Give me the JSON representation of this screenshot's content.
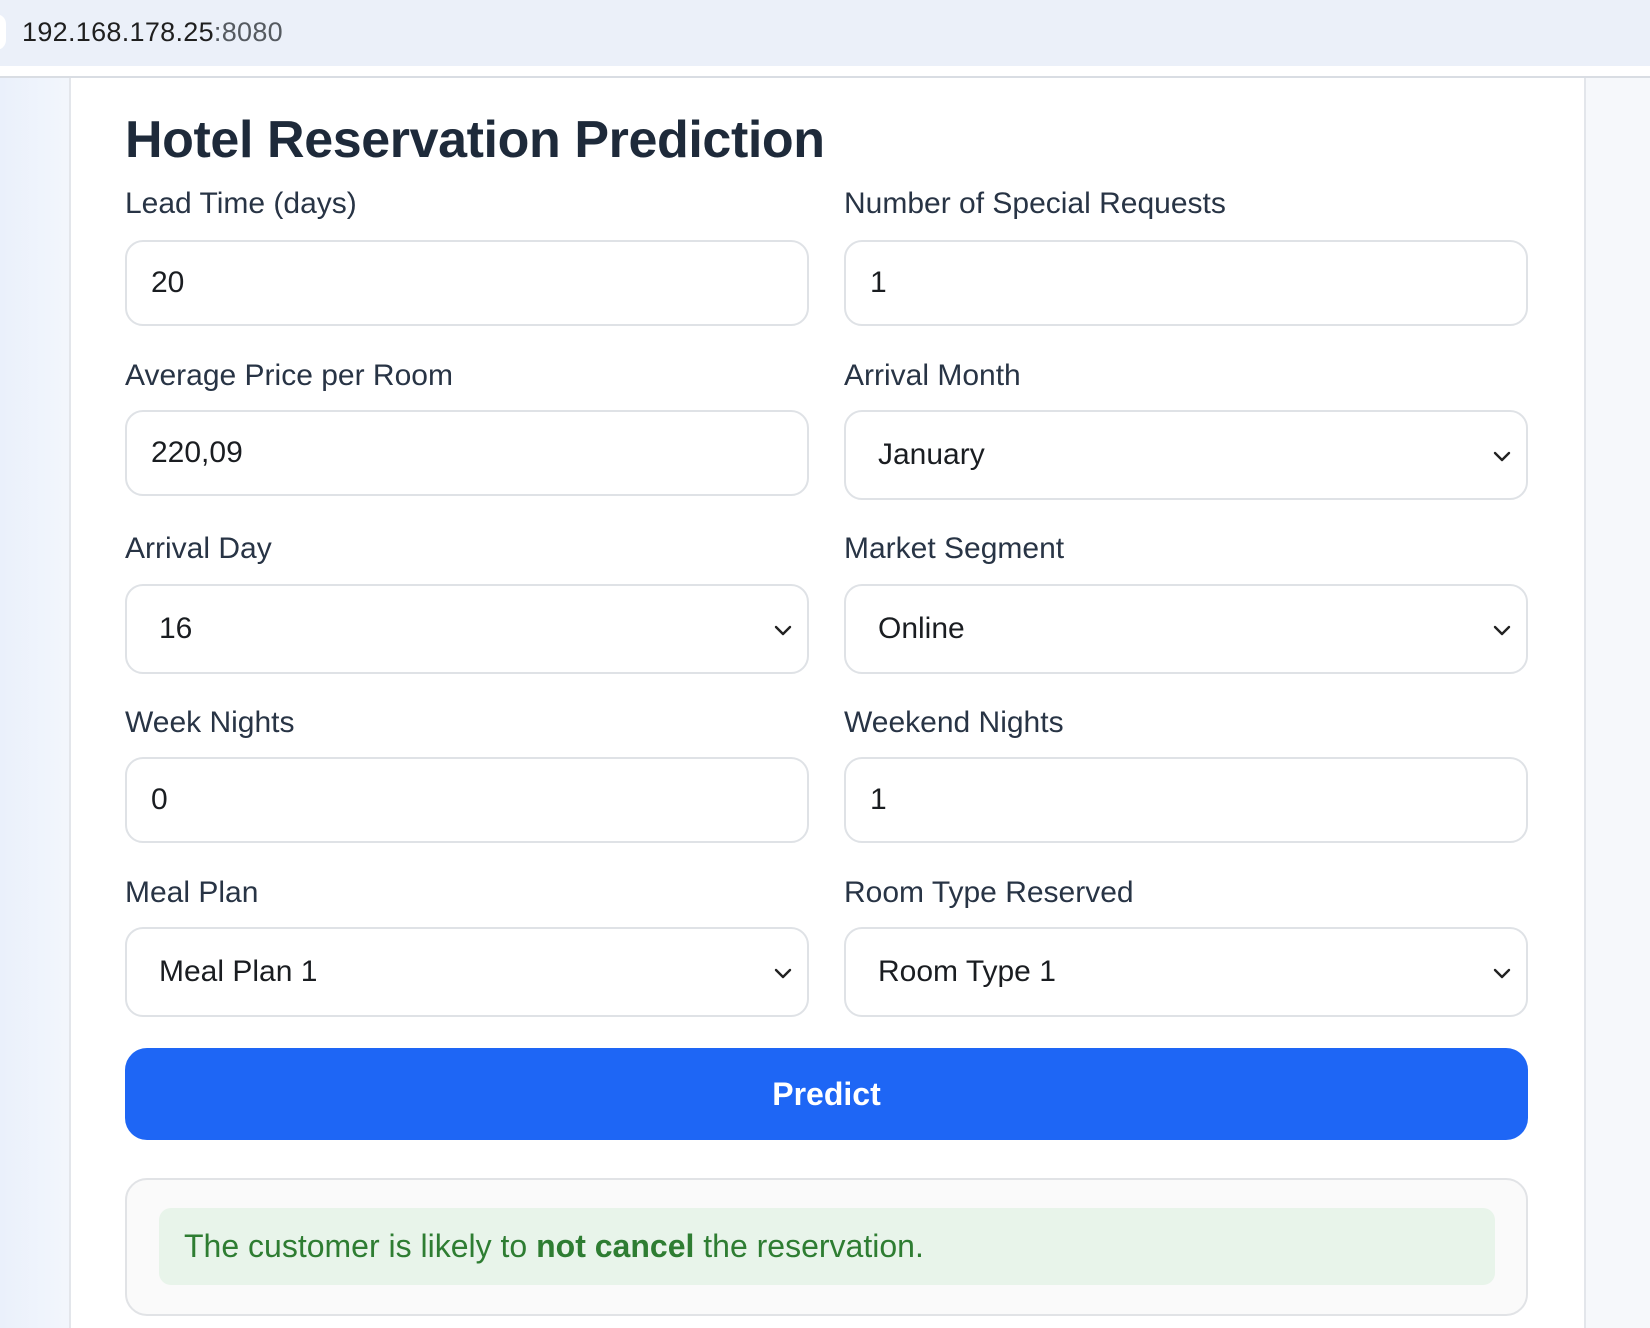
{
  "browser": {
    "url_host": "192.168.178.25",
    "url_port": ":8080"
  },
  "page": {
    "title": "Hotel Reservation Prediction"
  },
  "form": {
    "lead_time": {
      "label": "Lead Time (days)",
      "value": "20"
    },
    "special_requests": {
      "label": "Number of Special Requests",
      "value": "1"
    },
    "avg_price": {
      "label": "Average Price per Room",
      "value": "220,09"
    },
    "arrival_month": {
      "label": "Arrival Month",
      "value": "January"
    },
    "arrival_day": {
      "label": "Arrival Day",
      "value": "16"
    },
    "market_segment": {
      "label": "Market Segment",
      "value": "Online"
    },
    "week_nights": {
      "label": "Week Nights",
      "value": "0"
    },
    "weekend_nights": {
      "label": "Weekend Nights",
      "value": "1"
    },
    "meal_plan": {
      "label": "Meal Plan",
      "value": "Meal Plan 1"
    },
    "room_type": {
      "label": "Room Type Reserved",
      "value": "Room Type 1"
    },
    "predict_label": "Predict"
  },
  "result": {
    "prefix": "The customer is likely to ",
    "emphasis": "not cancel",
    "suffix": " the reservation."
  },
  "colors": {
    "accent": "#1e66f5",
    "success_text": "#2e7d32",
    "success_bg": "#e8f4ea"
  }
}
